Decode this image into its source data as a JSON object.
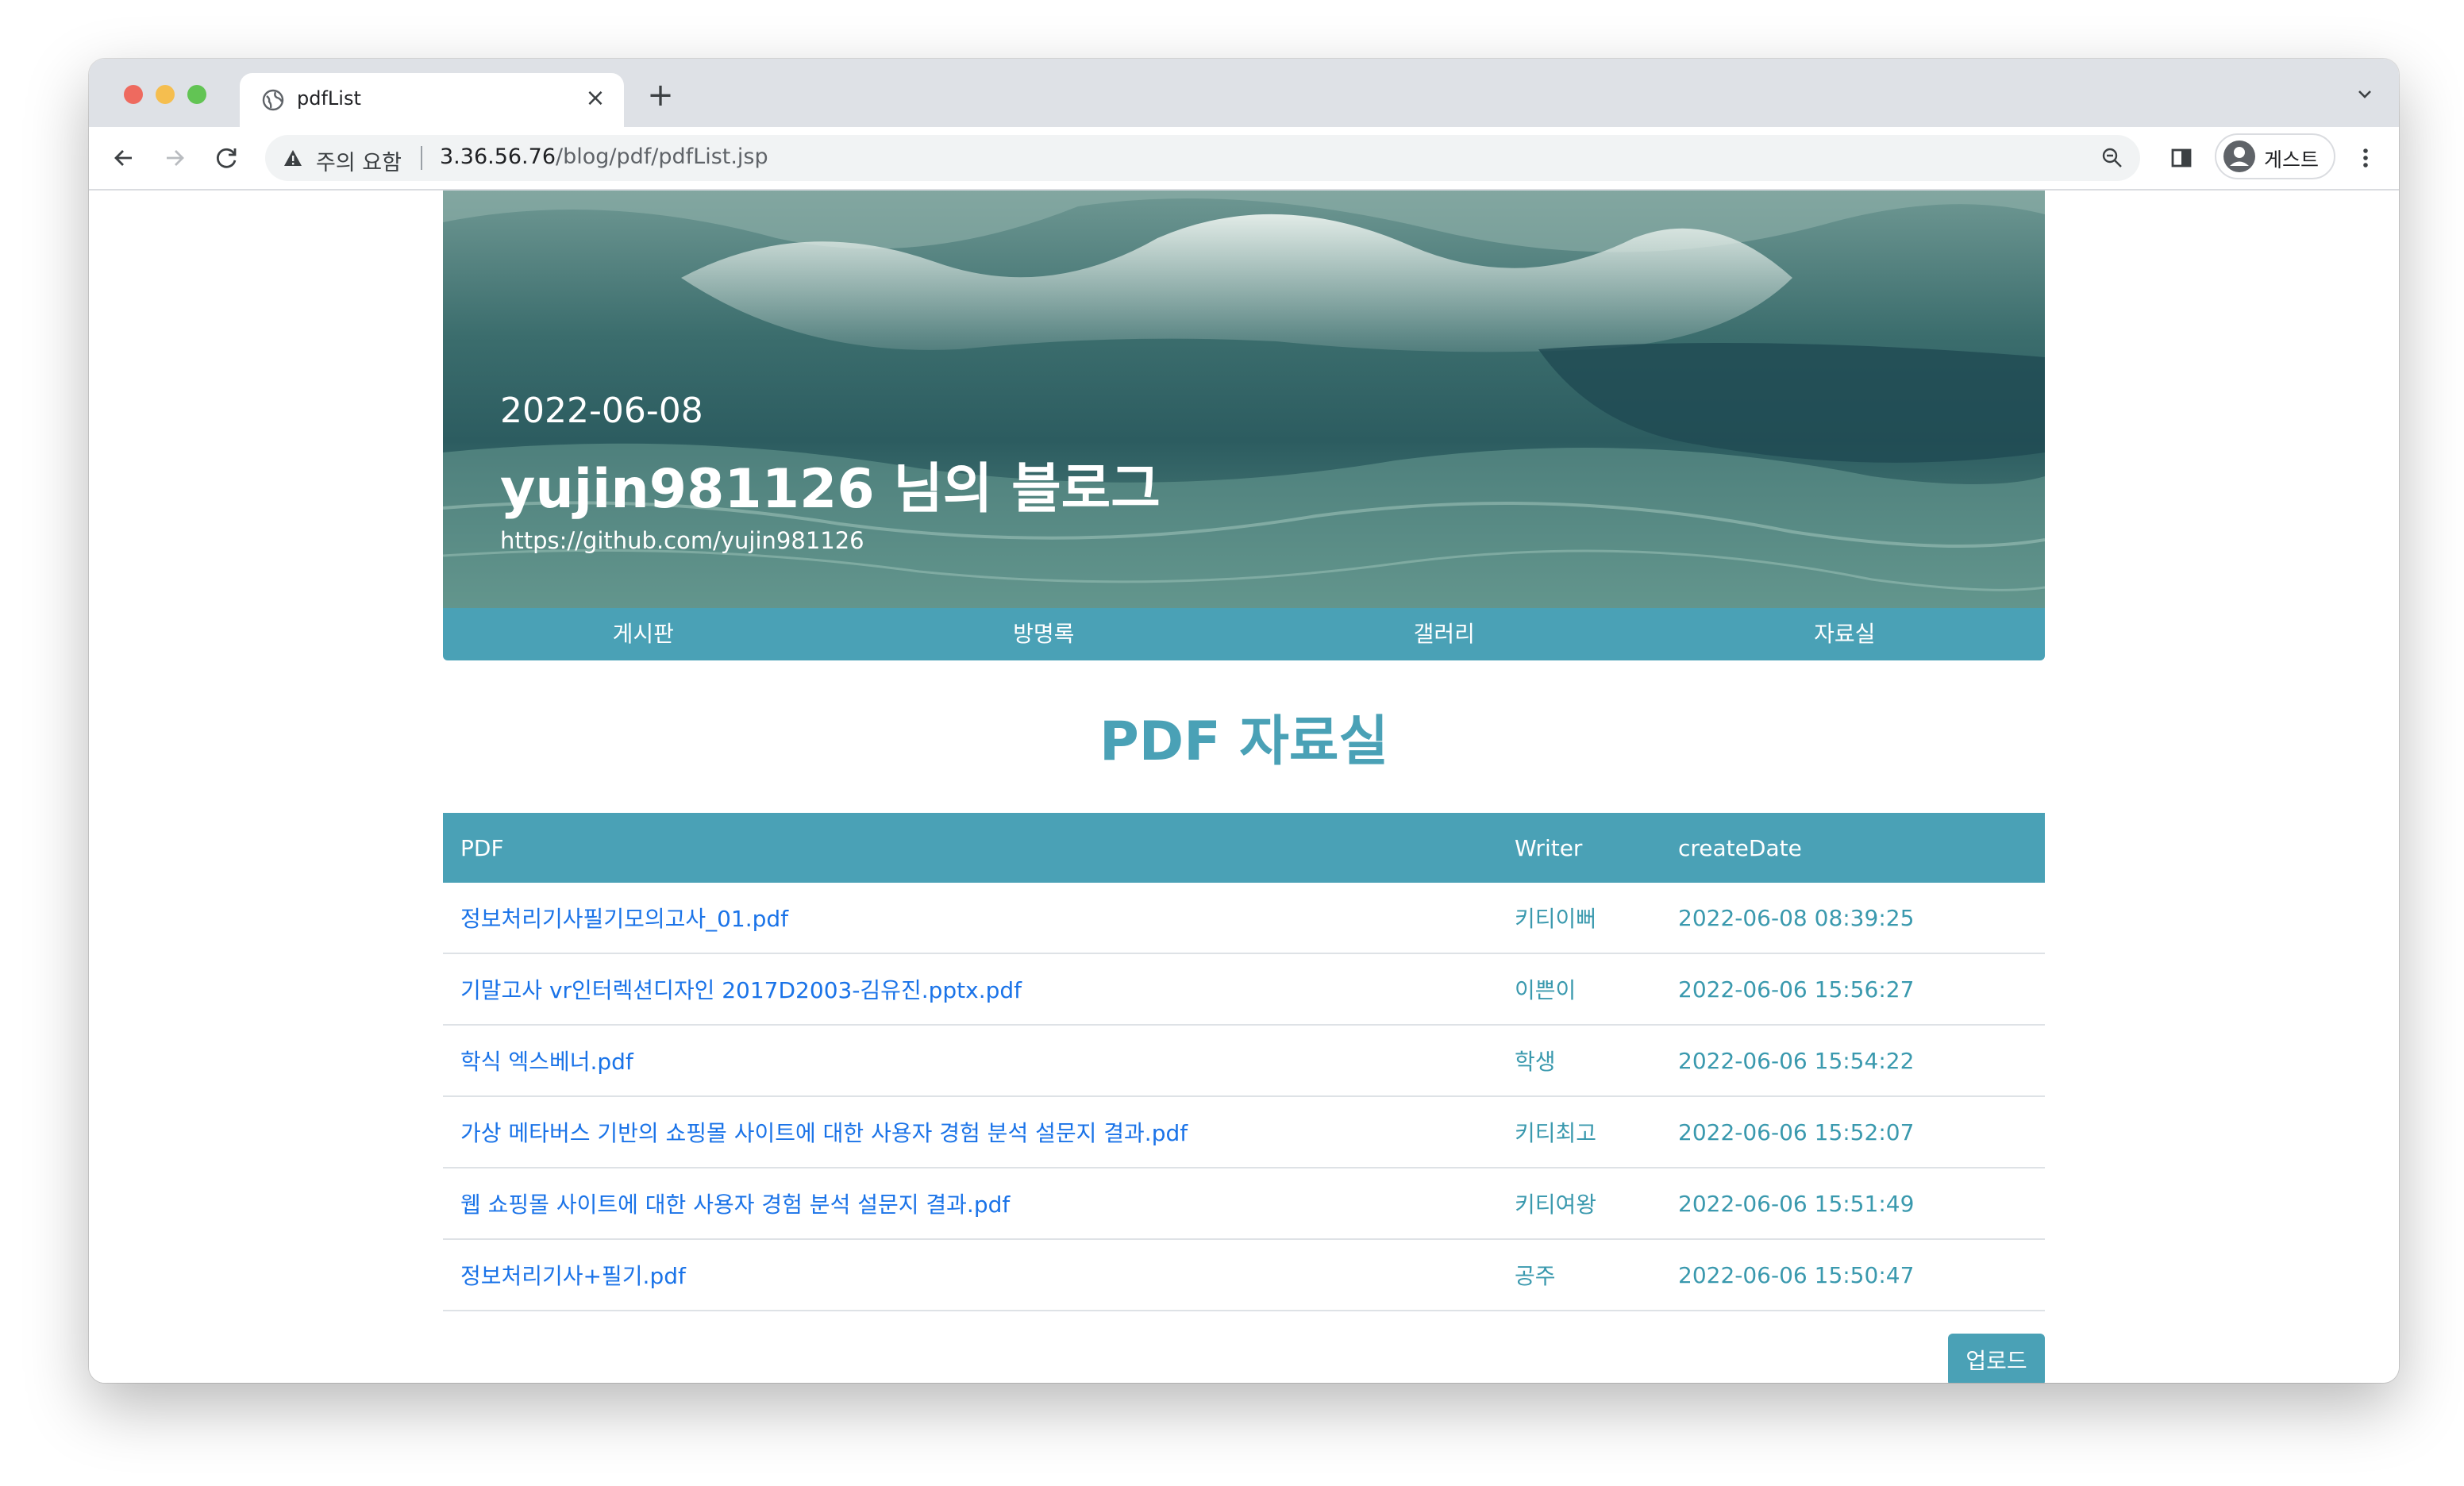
{
  "browser": {
    "tab_title": "pdfList",
    "security_label": "주의 요함",
    "url_host": "3.36.56.76",
    "url_path": "/blog/pdf/pdfList.jsp",
    "profile_label": "게스트"
  },
  "hero": {
    "date": "2022-06-08",
    "title": "yujin981126 님의 블로그",
    "link": "https://github.com/yujin981126"
  },
  "nav": {
    "items": [
      {
        "label": "게시판"
      },
      {
        "label": "방명록"
      },
      {
        "label": "갤러리"
      },
      {
        "label": "자료실"
      }
    ]
  },
  "page": {
    "heading": "PDF 자료실",
    "table_headers": [
      "PDF",
      "Writer",
      "createDate"
    ],
    "rows": [
      {
        "file": "정보처리기사필기모의고사_01.pdf",
        "writer": "키티이뻐",
        "date": "2022-06-08 08:39:25"
      },
      {
        "file": "기말고사 vr인터렉션디자인 2017D2003-김유진.pptx.pdf",
        "writer": "이쁜이",
        "date": "2022-06-06 15:56:27"
      },
      {
        "file": "학식 엑스베너.pdf",
        "writer": "학생",
        "date": "2022-06-06 15:54:22"
      },
      {
        "file": "가상 메타버스 기반의 쇼핑몰 사이트에 대한 사용자 경험 분석 설문지 결과.pdf",
        "writer": "키티최고",
        "date": "2022-06-06 15:52:07"
      },
      {
        "file": "웹 쇼핑몰 사이트에 대한 사용자 경험 분석 설문지 결과.pdf",
        "writer": "키티여왕",
        "date": "2022-06-06 15:51:49"
      },
      {
        "file": "정보처리기사+필기.pdf",
        "writer": "공주",
        "date": "2022-06-06 15:50:47"
      }
    ],
    "upload_label": "업로드"
  },
  "colors": {
    "accent": "#4aa1b6",
    "link": "#1a73e8",
    "meta_text": "#3a99ae"
  },
  "icons": {
    "tab_favicon": "globe-icon",
    "warning": "warning-triangle-icon",
    "zoom": "magnifier-icon",
    "side_panel": "side-panel-icon",
    "profile": "person-circle-icon",
    "menu": "kebab-menu-icon"
  }
}
